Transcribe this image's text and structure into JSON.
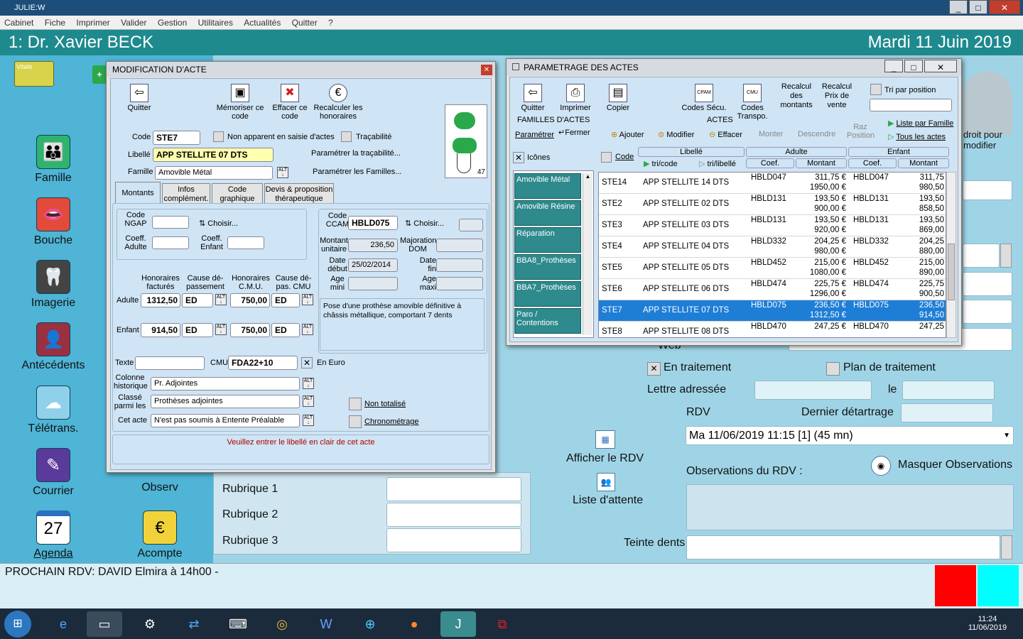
{
  "window": {
    "title": "JULIE:W",
    "controls": [
      "_",
      "□",
      "✕"
    ]
  },
  "menu": [
    "Cabinet",
    "Fiche",
    "Imprimer",
    "Valider",
    "Gestion",
    "Utilitaires",
    "Actualités",
    "Quitter",
    "?"
  ],
  "header": {
    "doctor": "1: Dr. Xavier BECK",
    "date": "Mardi 11 Juin 2019"
  },
  "sidebar": {
    "left": [
      {
        "label": "Famille",
        "icon": "family-icon"
      },
      {
        "label": "Bouche",
        "icon": "mouth-icon"
      },
      {
        "label": "Imagerie",
        "icon": "xray-icon"
      },
      {
        "label": "Antécédents",
        "icon": "history-icon"
      },
      {
        "label": "Télétrans.",
        "icon": "cloud-card-icon"
      },
      {
        "label": "Courrier",
        "icon": "pen-icon"
      },
      {
        "label": "Agenda",
        "icon": "calendar-icon",
        "day": "27"
      }
    ],
    "right": [
      {
        "label": "Observ",
        "icon": "observ-icon"
      },
      {
        "label": "Acompte",
        "icon": "euro-icon"
      }
    ]
  },
  "main": {
    "en_traitement": "En traitement",
    "plan_traitement": "Plan de traitement",
    "lettre": "Lettre adressée",
    "le": "le",
    "rdv": "RDV",
    "dernier": "Dernier détartrage",
    "rdv_select": "Ma 11/06/2019 11:15 [1] (45 mn)",
    "afficher_rdv": "Afficher le RDV",
    "liste_attente": "Liste d'attente",
    "obs_rdv": "Observations du RDV :",
    "masquer": "Masquer Observations",
    "rubriques": [
      "Rubrique 1",
      "Rubrique 2",
      "Rubrique 3"
    ],
    "teinte": "Teinte dents",
    "web": "Web",
    "droit": "droit pour",
    "modifier": "modifier"
  },
  "status": {
    "prochain": "PROCHAIN RDV: DAVID Elmira à 14h00 -",
    "colors": [
      "#ff0000",
      "#00ffff"
    ]
  },
  "taskbar": {
    "time": "11:24",
    "date": "11/06/2019"
  },
  "modif": {
    "title": "MODIFICATION D'ACTE",
    "close": "✕",
    "toolbar": {
      "quitter": "Quitter",
      "memoriser": "Mémoriser ce code",
      "effacer": "Effacer ce code",
      "recalculer": "Recalculer les honoraires"
    },
    "code_lbl": "Code",
    "code": "STE7",
    "non_apparent": "Non apparent en saisie d'actes",
    "tracabilite": "Traçabilité",
    "libelle_lbl": "Libellé",
    "libelle": "APP STELLITE 07 DTS",
    "param_trac": "Paramétrer la traçabilité...",
    "famille_lbl": "Famille",
    "famille": "Amovible Métal",
    "param_fam": "Paramétrer les Familles...",
    "tooth_num": "47",
    "tabs": [
      "Montants",
      "Infos complément.",
      "Code graphique",
      "Devis & proposition thérapeutique"
    ],
    "code_ngap": "Code NGAP",
    "choisir": "Choisir...",
    "coeff_adulte": "Coeff. Adulte",
    "coeff_enfant": "Coeff. Enfant",
    "code_ccam": "Code CCAM",
    "ccam": "HBLD075",
    "choisir2": "Choisir...",
    "montant_unit_lbl": "Montant unitaire",
    "montant_unit": "236,50",
    "majoration": "Majoration DOM",
    "date_debut_lbl": "Date début",
    "date_debut": "25/02/2014",
    "date_fin": "Date fin",
    "age_mini": "Age mini",
    "age_maxi": "Age maxi",
    "description": "Pose d'une prothèse amovible définitive à châssis métallique, comportant 7 dents",
    "h_fact": "Honoraires facturés",
    "cause_dep": "Cause dé-passement",
    "h_cmu": "Honoraires C.M.U.",
    "cause_cmu": "Cause dé-pas. CMU",
    "adulte_lbl": "Adulte",
    "adulte_h": "1312,50",
    "adulte_c": "ED",
    "adulte_cmu": "750,00",
    "adulte_cc": "ED",
    "enfant_lbl": "Enfant",
    "enfant_h": "914,50",
    "enfant_c": "ED",
    "enfant_cmu": "750,00",
    "enfant_cc": "ED",
    "texte": "Texte",
    "cmu_lbl": "CMU",
    "cmu": "FDA22+10",
    "en_euro": "En Euro",
    "colonne_lbl": "Colonne historique",
    "colonne": "Pr. Adjointes",
    "classe_lbl": "Classé parmi les",
    "classe": "Prothèses adjointes",
    "cet_acte_lbl": "Cet acte",
    "cet_acte": "N'est pas soumis à Entente Préalable",
    "non_totalise": "Non totalisé",
    "chrono": "Chronométrage",
    "warning": "Veuillez entrer le libellé en clair de cet acte"
  },
  "param": {
    "title": "PARAMETRAGE DES ACTES",
    "toolbar": {
      "quitter": "Quitter",
      "imprimer": "Imprimer",
      "copier": "Copier",
      "codes_secu": "Codes Sécu.",
      "codes_transpo": "Codes Transpo.",
      "recalcul_montants": "Recalcul des montants",
      "recalcul_prix": "Recalcul Prix de vente",
      "tri_position": "Tri par position"
    },
    "familles": "FAMILLES D'ACTES",
    "parametrer": "Paramétrer",
    "fermer": "Fermer",
    "icones": "Icônes",
    "actes": "ACTES",
    "ajouter": "Ajouter",
    "modifier": "Modifier",
    "effacer": "Effacer",
    "monter": "Monter",
    "descendre": "Descendre",
    "raz": "Raz Position",
    "liste_famille": "Liste par Famille",
    "tous": "Tous les actes",
    "cols": {
      "code": "Code",
      "libelle": "Libellé",
      "tri_code": "tri/code",
      "tri_lib": "tri/libellé",
      "adulte": "Adulte",
      "enfant": "Enfant",
      "coef": "Coef.",
      "montant": "Montant"
    },
    "families": [
      {
        "name": "Amovible Métal"
      },
      {
        "name": "Amovible Résine"
      },
      {
        "name": "Réparation"
      },
      {
        "name": "BBA8_Prothèses"
      },
      {
        "name": "BBA7_Prothèses"
      },
      {
        "name": "Paro / Contentions"
      }
    ],
    "rows": [
      {
        "code": "STE14",
        "lib": "APP STELLITE 14 DTS",
        "ac": "HBLD047",
        "am": "311,75 €",
        "am2": "1950,00 €",
        "ec": "HBLD047",
        "em": "311,75",
        "em2": "980,50"
      },
      {
        "code": "STE2",
        "lib": "APP STELLITE 02 DTS",
        "ac": "HBLD131",
        "am": "193,50 €",
        "am2": "900,00 €",
        "ec": "HBLD131",
        "em": "193,50",
        "em2": "858,50"
      },
      {
        "code": "STE3",
        "lib": "APP STELLITE 03 DTS",
        "ac": "HBLD131",
        "am": "193,50 €",
        "am2": "920,00 €",
        "ec": "HBLD131",
        "em": "193,50",
        "em2": "869,00"
      },
      {
        "code": "STE4",
        "lib": "APP STELLITE 04 DTS",
        "ac": "HBLD332",
        "am": "204,25 €",
        "am2": "980,00 €",
        "ec": "HBLD332",
        "em": "204,25",
        "em2": "880,00"
      },
      {
        "code": "STE5",
        "lib": "APP STELLITE 05 DTS",
        "ac": "HBLD452",
        "am": "215,00 €",
        "am2": "1080,00 €",
        "ec": "HBLD452",
        "em": "215,00",
        "em2": "890,00"
      },
      {
        "code": "STE6",
        "lib": "APP STELLITE 06 DTS",
        "ac": "HBLD474",
        "am": "225,75 €",
        "am2": "1296,00 €",
        "ec": "HBLD474",
        "em": "225,75",
        "em2": "900,50"
      },
      {
        "code": "STE7",
        "lib": "APP STELLITE 07 DTS",
        "ac": "HBLD075",
        "am": "236,50 €",
        "am2": "1312,50 €",
        "ec": "HBLD075",
        "em": "236,50",
        "em2": "914,50",
        "selected": true
      },
      {
        "code": "STE8",
        "lib": "APP STELLITE 08 DTS",
        "ac": "HBLD470",
        "am": "247,25 €",
        "am2": "",
        "ec": "HBLD470",
        "em": "247,25",
        "em2": ""
      }
    ]
  }
}
